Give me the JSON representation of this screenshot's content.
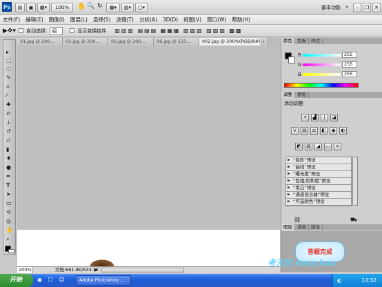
{
  "appbar": {
    "ps_logo": "Ps",
    "zoom_value": "100%",
    "workspace_label": "基本功能",
    "icons": [
      "file-browser-icon",
      "bridge-icon",
      "guides-icon",
      "hand-icon",
      "zoom-icon",
      "rotate-icon",
      "grid-icon",
      "arrange-icon",
      "screen-mode-icon"
    ]
  },
  "menu": [
    "文件(F)",
    "编辑(E)",
    "图像(I)",
    "图层(L)",
    "选择(S)",
    "滤镜(T)",
    "分析(A)",
    "3D(D)",
    "视图(V)",
    "窗口(W)",
    "帮助(H)"
  ],
  "options": {
    "auto_select_label": "自动选择:",
    "auto_select_value": "组",
    "show_transform_label": "显示变换控件"
  },
  "doc_tabs": [
    {
      "label": "01.jpg @ 200...",
      "active": false
    },
    {
      "label": "02.jpg @ 200...",
      "active": false
    },
    {
      "label": "03.jpg @ 200...",
      "active": false
    },
    {
      "label": "06.jpg @ 133...",
      "active": false
    },
    {
      "label": "002.jpg @ 200%(RGB/8#)",
      "active": true
    }
  ],
  "status": {
    "zoom": "200%",
    "doc_info": "文档:661.8K/634.7K"
  },
  "color_panel": {
    "tabs": [
      "颜色",
      "色板",
      "样式"
    ],
    "channels": [
      {
        "label": "R",
        "value": "255",
        "gradient": "#00ffff"
      },
      {
        "label": "G",
        "value": "255",
        "gradient": "#ff00ff"
      },
      {
        "label": "B",
        "value": "255",
        "gradient": "#ffff00"
      }
    ]
  },
  "adjust_panel": {
    "tabs": [
      "调整",
      "蒙版"
    ],
    "title": "添加调整",
    "presets": [
      "“色阶”预设",
      "“曲线”预设",
      "“曝光度”预设",
      "“色相/饱和度”预设",
      "“黑白”预设",
      "“通道混合器”预设",
      "“可选颜色”预设"
    ]
  },
  "layers_panel": {
    "tabs": [
      "图层",
      "通道",
      "路径"
    ]
  },
  "overlay": {
    "bubble_text": "答题完成",
    "watermark": "考无忧 easy.kao"
  },
  "taskbar": {
    "start_label": "开始",
    "task_label": "Adobe Photoshop ...",
    "clock": "14:32"
  }
}
